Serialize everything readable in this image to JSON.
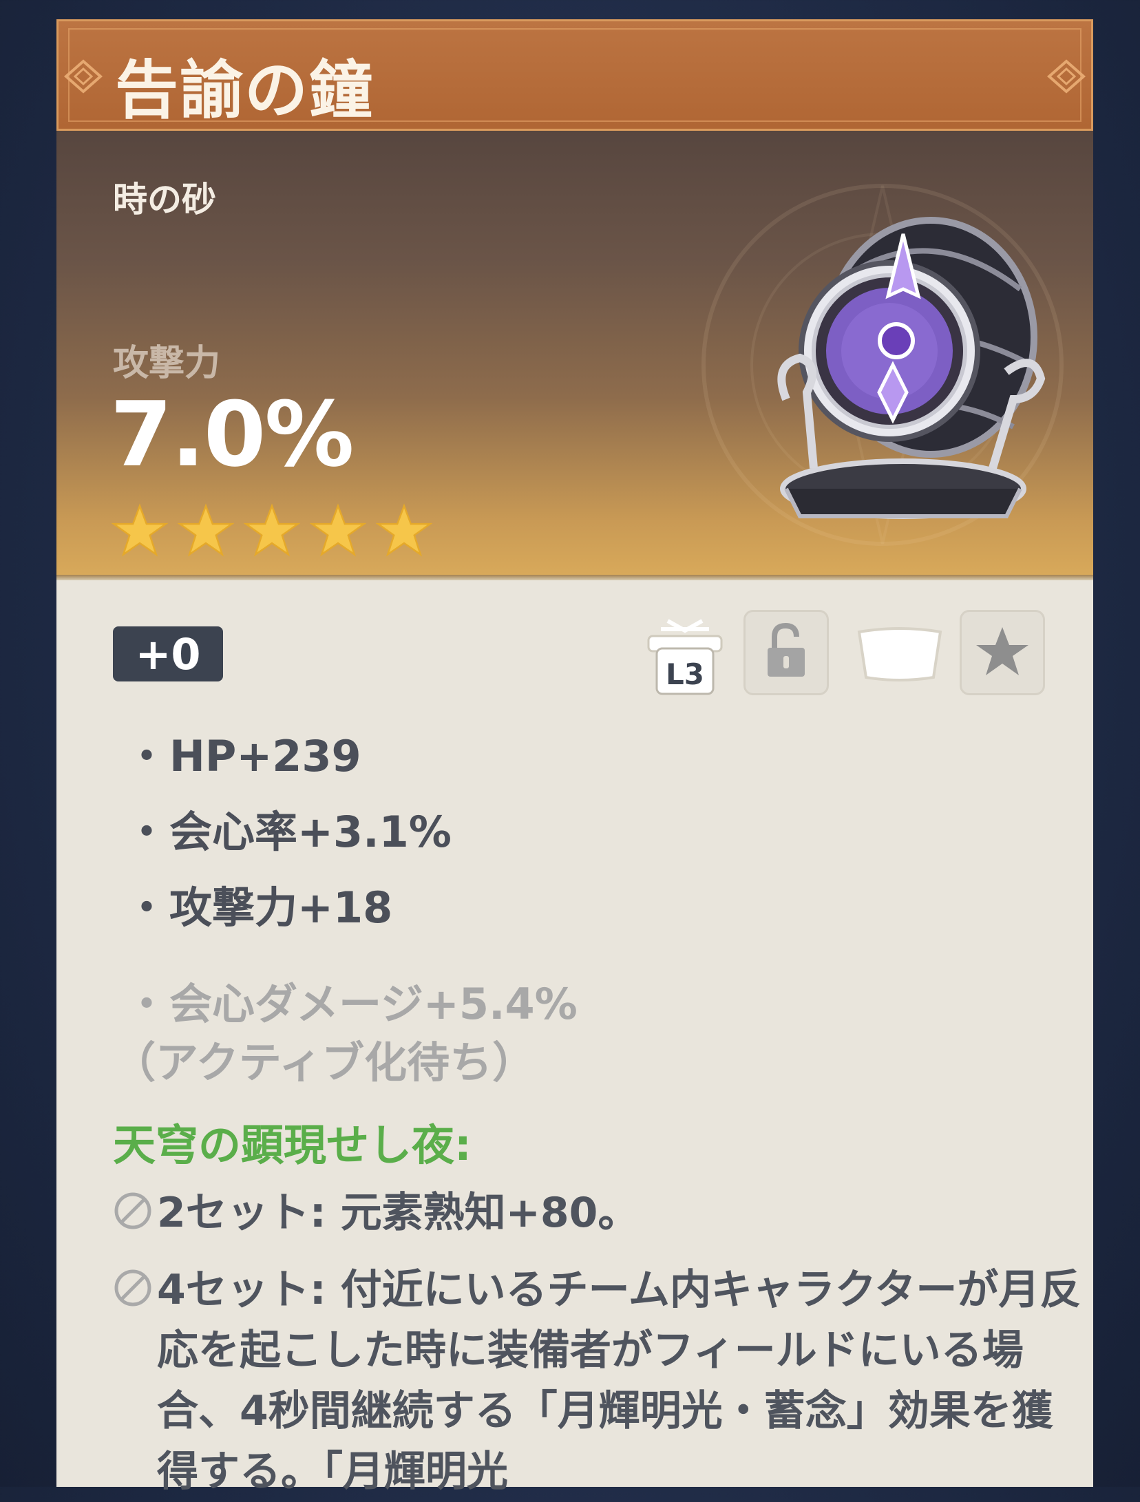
{
  "artifact": {
    "name": "告諭の鐘",
    "piece_type": "時の砂",
    "main_stat_name": "攻撃力",
    "main_stat_value": "7.0%",
    "rarity_stars": 5,
    "level": "+0"
  },
  "actions": {
    "l3_label": "L3"
  },
  "substats": [
    {
      "text": "HP+239",
      "active": true
    },
    {
      "text": "会心率+3.1%",
      "active": true
    },
    {
      "text": "攻撃力+18",
      "active": true
    },
    {
      "text": "会心ダメージ+5.4%",
      "active": false
    }
  ],
  "substat_bullet": "・",
  "inactive_note": "（アクティブ化待ち）",
  "set": {
    "name": "天穹の顕現せし夜:",
    "bonus_2": "2セット: 元素熟知+80。",
    "bonus_4": "4セット: 付近にいるチーム内キャラクターが月反応を起こした時に装備者がフィールドにいる場合、4秒間継続する「月輝明光・蓄念」効果を獲得する。「月輝明光"
  },
  "colors": {
    "title_bar": "#b46a37",
    "set_name_green": "#5aae4a",
    "star_gold": "#f6c64a"
  }
}
